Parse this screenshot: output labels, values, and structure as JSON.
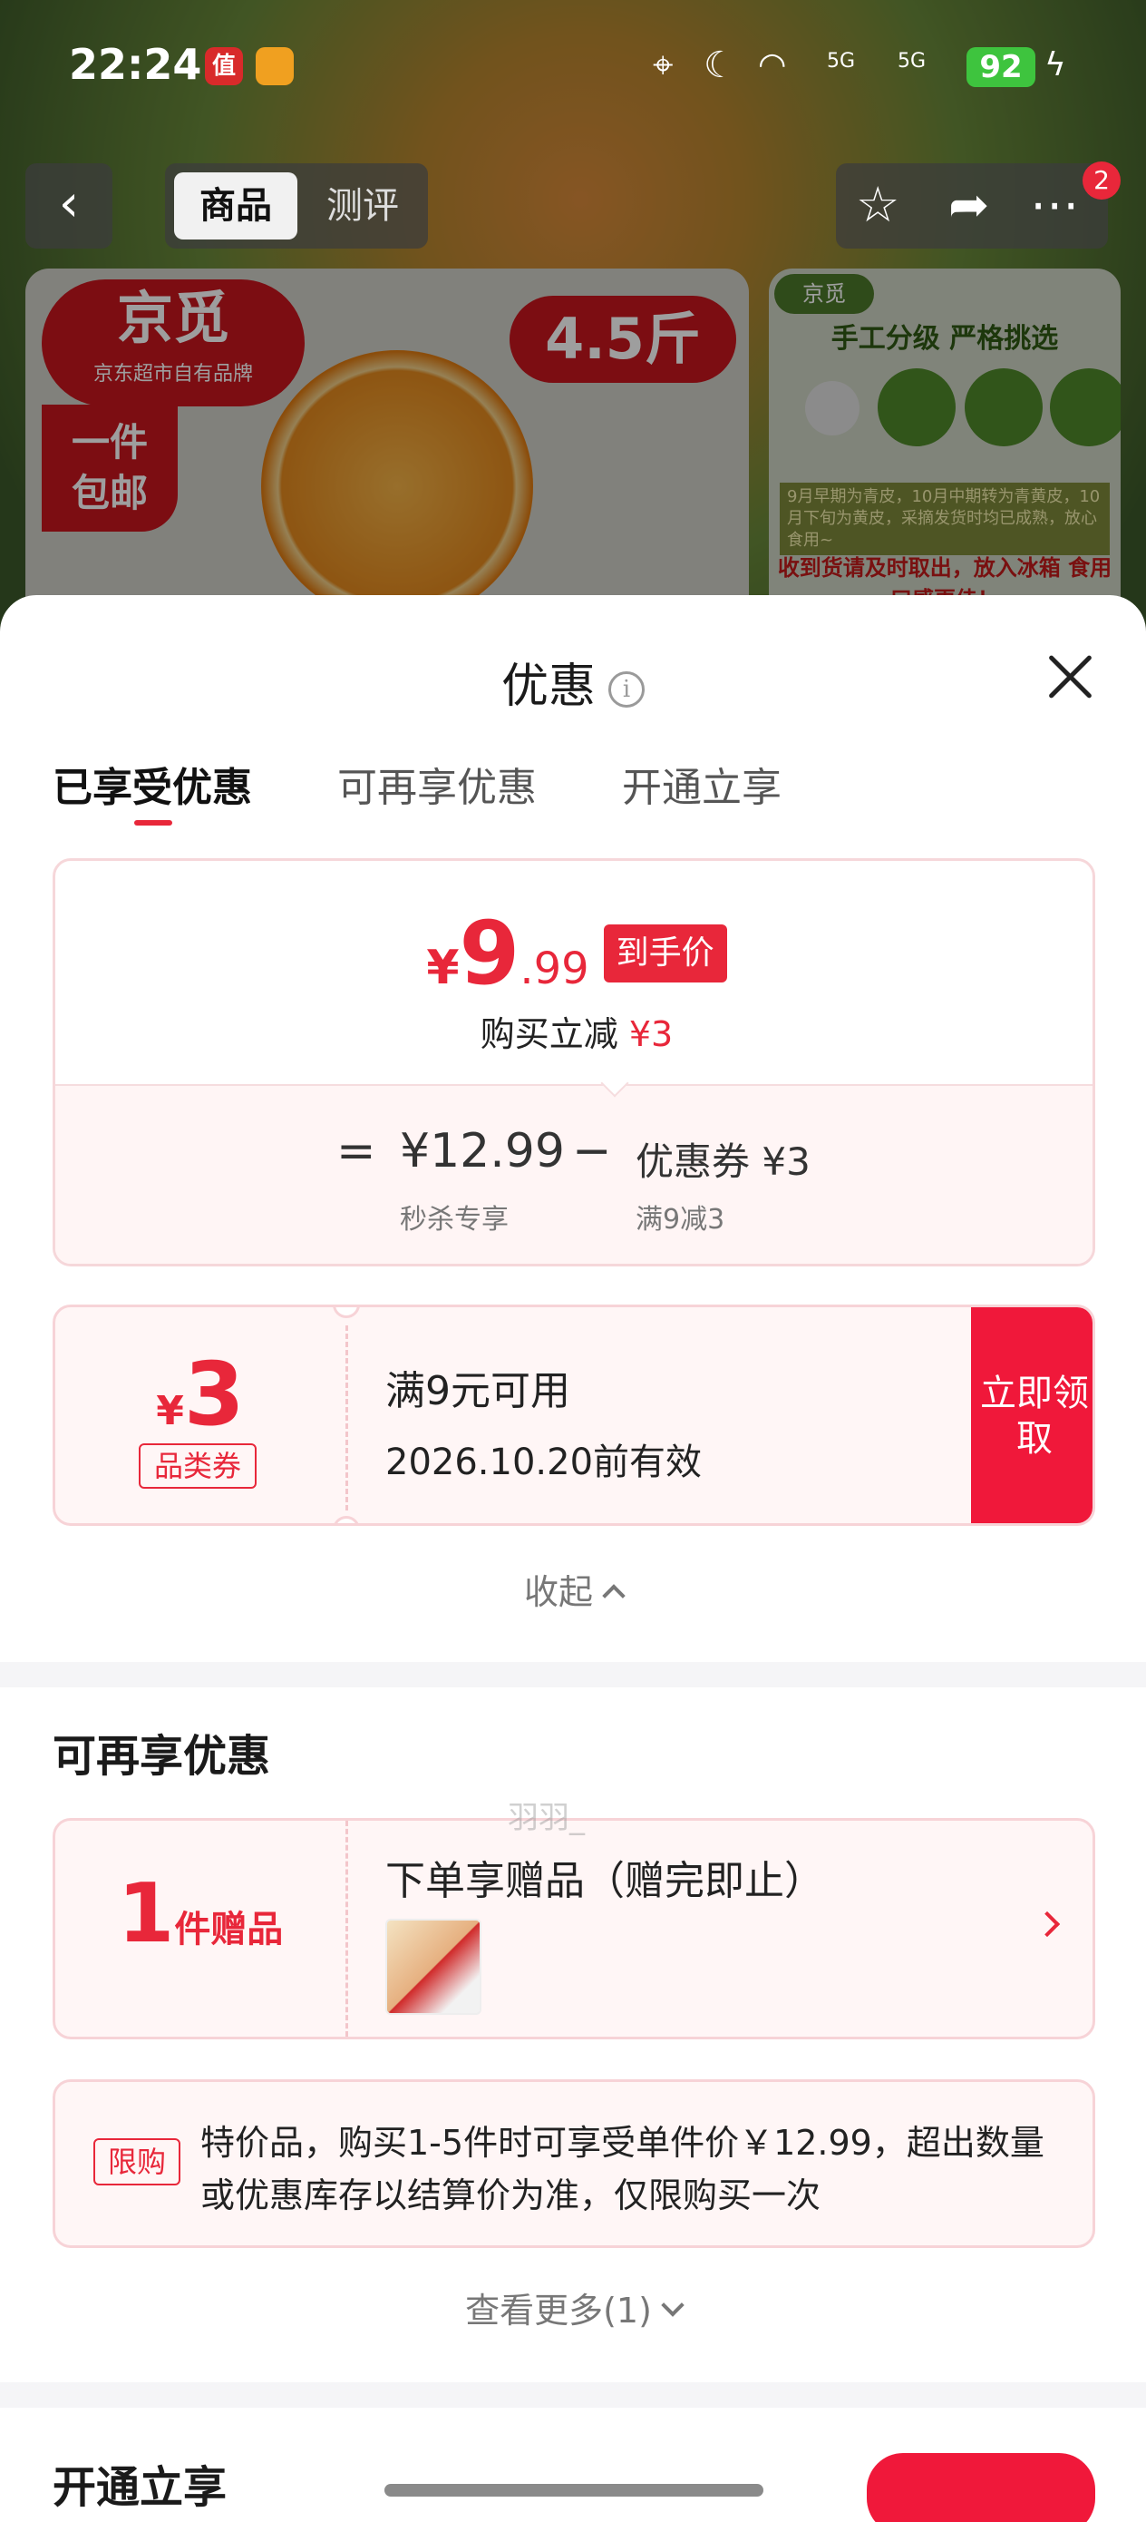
{
  "status_bar": {
    "time": "22:24",
    "app1": "值",
    "app2": "",
    "battery": "92",
    "network1": "5G",
    "network2": "5G"
  },
  "nav": {
    "tab_product": "商品",
    "tab_review": "测评",
    "badge": "2"
  },
  "promo_left": {
    "brand": "京觅",
    "brand_sub": "京东超市自有品牌",
    "weight": "4.5斤",
    "shipping": "一件\n包邮"
  },
  "promo_right": {
    "tag": "京觅",
    "headline": "手工分级 严格挑选",
    "note": "9月早期为青皮，10月中期转为青黄皮，10月下旬为黄皮，采摘发货时均已成熟，放心食用~",
    "red_text": "收到货请及时取出，放入冰箱 食用口感更佳！"
  },
  "sheet": {
    "title": "优惠",
    "tabs": [
      "已享受优惠",
      "可再享优惠",
      "开通立享"
    ]
  },
  "price_card": {
    "currency": "¥",
    "price_int": "9",
    "price_dec": ".99",
    "price_tag": "到手价",
    "sub_prefix": "购买立减",
    "sub_amount": "¥3",
    "equals": "=",
    "original_price": "¥12.99",
    "minus": "−",
    "coupon_label": "优惠券 ¥3",
    "original_note": "秒杀专享",
    "coupon_note": "满9减3"
  },
  "coupon": {
    "currency": "¥",
    "amount": "3",
    "kind": "品类券",
    "condition": "满9元可用",
    "expiry": "2026.10.20前有效",
    "claim_label": "立即领取"
  },
  "collapse_label": "收起",
  "more_offers": {
    "title": "可再享优惠",
    "gift_count": "1",
    "gift_unit": "件赠品",
    "gift_title": "下单享赠品（赠完即止）",
    "limit_tag": "限购",
    "limit_text": "特价品，购买1-5件时可享受单件价￥12.99，超出数量或优惠库存以结算价为准，仅限购买一次",
    "view_more": "查看更多(1)"
  },
  "bottom_section": {
    "title": "开通立享"
  },
  "watermark": "羽羽_"
}
